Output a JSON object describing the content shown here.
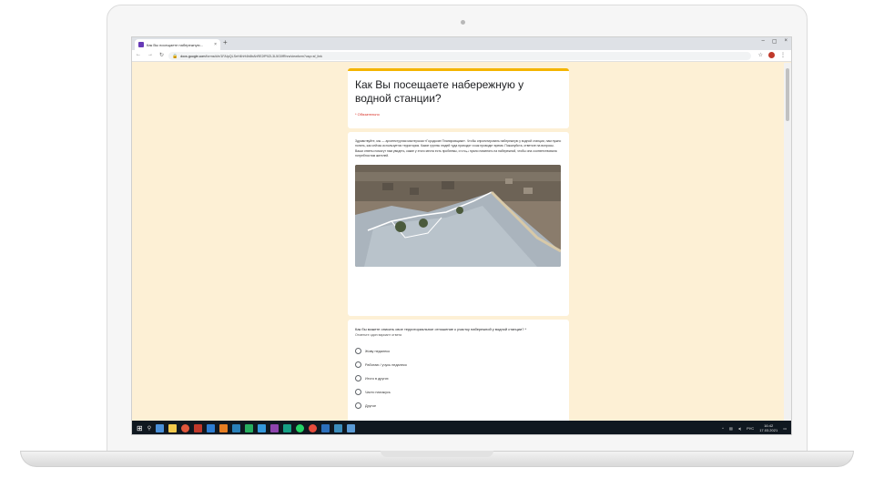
{
  "browser": {
    "tab_title": "Как Вы посещаете набережную...",
    "tab_close": "×",
    "new_tab": "+",
    "controls": [
      "–",
      "▢",
      "×"
    ],
    "url_domain": "docs.google.com",
    "url_path": "/forms/d/e/1FAIpQLSeH4hH4h8bAhRE2fP0ZL3L5G0fRhrs/viewform?usp=sf_link"
  },
  "form": {
    "title": "Как Вы посещаете набережную у водной станции?",
    "required_note": "* Обязательно",
    "intro": "Здравствуйте, мы — архитектурная мастерская «Городские Планировщики». Чтобы спроектировать набережную у водной станции, нам нужно понять, как сейчас используется территория. Какие группы людей туда приходят и как проводят время. Пожалуйста, ответьте на вопросы. Ваши ответы помогут нам увидеть, какие у этого места есть проблемы, и чтоده нужно поменять на набережной, чтобы она соответствовала потребностям жителей.",
    "photo_alt": "aerial photo of the embankment"
  },
  "question": {
    "text": "Как бы можете описать свое территориальное отношение к участку набережной у водной станции? *",
    "hint": "Отметьте один вариант ответа",
    "options": [
      "Живу недалеко",
      "Работаю / учусь недалеко",
      "Итого в других",
      "Часто нахожусь",
      "Другое"
    ]
  },
  "taskbar": {
    "tray_lang": "РУС",
    "time": "16:42",
    "date": "17.03.2021"
  },
  "colors": {
    "page_bg": "#fdf0d5",
    "form_accent": "#f4b400",
    "taskbar": "#101820"
  }
}
